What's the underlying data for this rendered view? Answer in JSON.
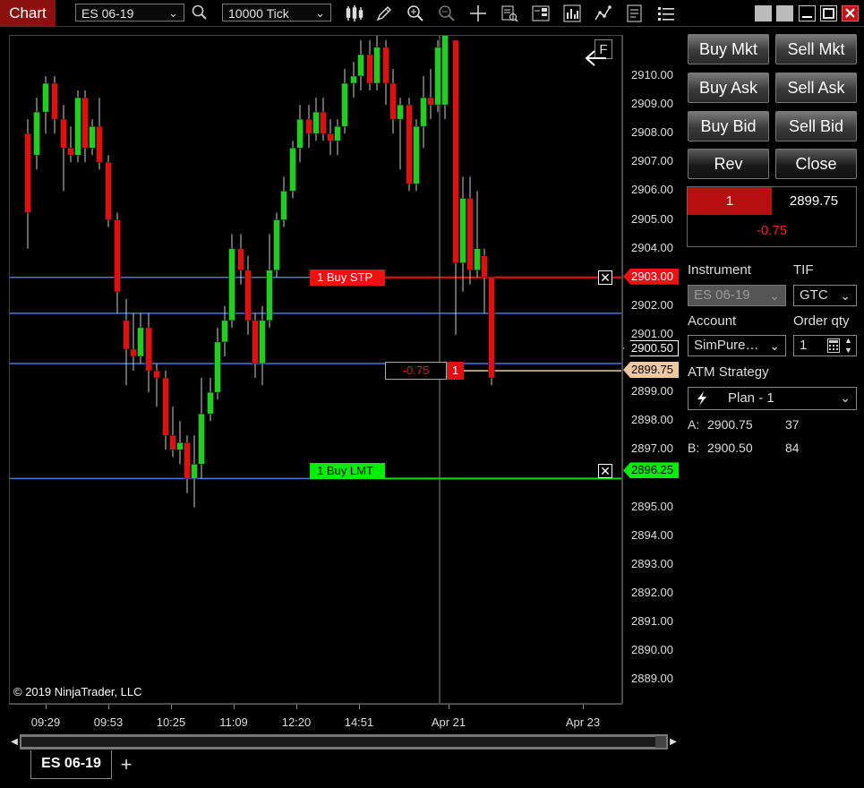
{
  "toolbar": {
    "chart_tab": "Chart",
    "instrument": "ES 06-19",
    "interval": "10000 Tick"
  },
  "chart": {
    "copyright": "© 2019 NinjaTrader, LLC",
    "f_button": "F",
    "buy_stp_label": "1  Buy STP",
    "buy_lmt_label": "1  Buy LMT",
    "position_pnl": "-0.75",
    "position_qty": "1"
  },
  "price_axis": {
    "labels": [
      "2910.00",
      "2909.00",
      "2908.00",
      "2907.00",
      "2906.00",
      "2905.00",
      "2904.00",
      "2903.00",
      "2902.00",
      "2901.00",
      "2900.50",
      "2899.75",
      "2899.00",
      "2898.00",
      "2897.00",
      "2896.25",
      "2895.00",
      "2894.00",
      "2893.00",
      "2892.00",
      "2891.00",
      "2890.00",
      "2889.00"
    ],
    "stop_price": "2903.00",
    "last_price": "2900.50",
    "position_price": "2899.75",
    "limit_price": "2896.25"
  },
  "time_axis": {
    "labels": [
      "09:29",
      "09:53",
      "10:25",
      "11:09",
      "12:20",
      "14:51",
      "Apr 21",
      "Apr 23"
    ]
  },
  "panel": {
    "buy_mkt": "Buy Mkt",
    "sell_mkt": "Sell Mkt",
    "buy_ask": "Buy Ask",
    "sell_ask": "Sell Ask",
    "buy_bid": "Buy Bid",
    "sell_bid": "Sell Bid",
    "rev": "Rev",
    "close": "Close",
    "position_qty": "1",
    "position_avg": "2899.75",
    "position_pnl": "-0.75",
    "instrument_label": "Instrument",
    "tif_label": "TIF",
    "instrument_value": "ES 06-19",
    "tif_value": "GTC",
    "account_label": "Account",
    "order_qty_label": "Order qty",
    "account_value": "SimPure…",
    "order_qty_value": "1",
    "atm_label": "ATM Strategy",
    "atm_value": "Plan - 1",
    "ask_label": "A:",
    "ask_price": "2900.75",
    "ask_size": "37",
    "bid_label": "B:",
    "bid_price": "2900.50",
    "bid_size": "84"
  },
  "bottom": {
    "tab": "ES 06-19",
    "add": "+"
  },
  "colors": {
    "up_candle": "#22cc22",
    "down_candle": "#dd1111",
    "stop_line": "#ee1111",
    "limit_line": "#00dd00",
    "price_line": "#4a78d8",
    "position_tag": "#f0c8a0"
  }
}
